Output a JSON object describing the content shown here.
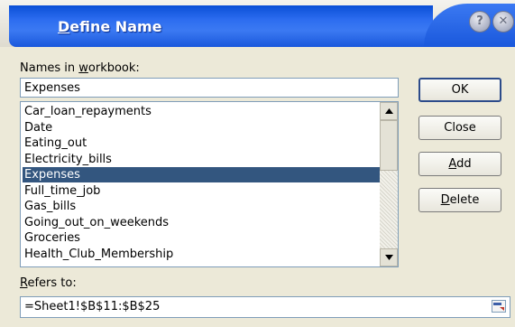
{
  "dialog": {
    "title": "Define Name",
    "help_icon": "help-icon",
    "close_icon": "close-icon"
  },
  "names_label": "Names in workbook:",
  "name_input": {
    "value": "Expenses"
  },
  "names_list": [
    "Car_loan_repayments",
    "Date",
    "Eating_out",
    "Electricity_bills",
    "Expenses",
    "Full_time_job",
    "Gas_bills",
    "Going_out_on_weekends",
    "Groceries",
    "Health_Club_Membership"
  ],
  "selected_index": 4,
  "buttons": {
    "ok": "OK",
    "close": "Close",
    "add": "Add",
    "delete": "Delete"
  },
  "refers_label": "Refers to:",
  "refers_input": {
    "value": "=Sheet1!$B$11:$B$25"
  },
  "colors": {
    "title_blue": "#2d6df0",
    "selection": "#33567f"
  }
}
